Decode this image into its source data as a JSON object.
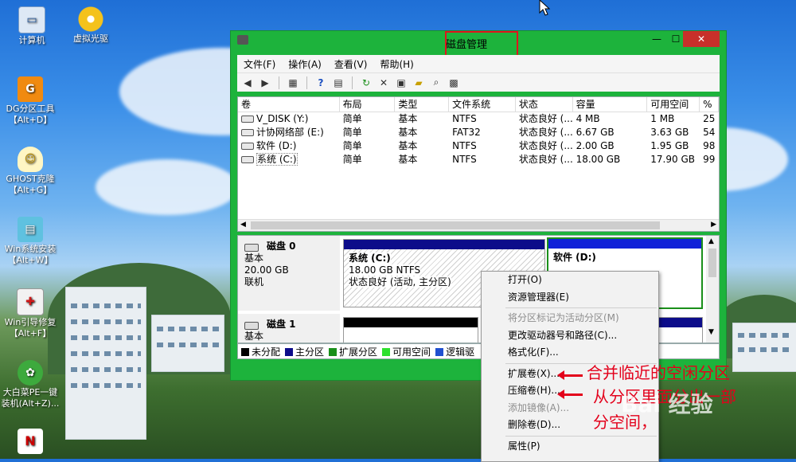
{
  "desktop": {
    "icons": [
      {
        "label": "计算机",
        "icon": "computer-icon"
      },
      {
        "label": "虚拟光驱",
        "icon": "disc-icon"
      },
      {
        "label": "DG分区工具",
        "label2": "【Alt+D】",
        "icon": "diskgenius-icon"
      },
      {
        "label": "GHOST克隆",
        "label2": "【Alt+G】",
        "icon": "ghost-icon"
      },
      {
        "label": "Win系统安装",
        "label2": "【Alt+W】",
        "icon": "win-install-icon"
      },
      {
        "label": "Win引导修复",
        "label2": "【Alt+F】",
        "icon": "boot-repair-icon"
      },
      {
        "label": "大白菜PE一键",
        "label2": "装机(Alt+Z)...",
        "icon": "cabbage-icon"
      }
    ]
  },
  "window": {
    "title": "磁盘管理",
    "min": "—",
    "max": "☐",
    "close": "✕",
    "menu": [
      "文件(F)",
      "操作(A)",
      "查看(V)",
      "帮助(H)"
    ]
  },
  "volumes": {
    "columns": [
      "卷",
      "布局",
      "类型",
      "文件系统",
      "状态",
      "容量",
      "可用空间",
      "%"
    ],
    "rows": [
      [
        "V_DISK (Y:)",
        "简单",
        "基本",
        "NTFS",
        "状态良好 (...",
        "4 MB",
        "1 MB",
        "25"
      ],
      [
        "计协网络部 (E:)",
        "简单",
        "基本",
        "FAT32",
        "状态良好 (...",
        "6.67 GB",
        "3.63 GB",
        "54"
      ],
      [
        "软件 (D:)",
        "简单",
        "基本",
        "NTFS",
        "状态良好 (...",
        "2.00 GB",
        "1.95 GB",
        "98"
      ],
      [
        "系统 (C:)",
        "简单",
        "基本",
        "NTFS",
        "状态良好 (...",
        "18.00 GB",
        "17.90 GB",
        "99"
      ]
    ]
  },
  "disks": {
    "disk0": {
      "name": "磁盘 0",
      "type": "基本",
      "size": "20.00 GB",
      "status": "联机"
    },
    "disk1": {
      "name": "磁盘 1",
      "type": "基本"
    },
    "partC": {
      "name": "系统  (C:)",
      "size": "18.00 GB NTFS",
      "status": "状态良好 (活动, 主分区)"
    },
    "partD": {
      "name": "软件  (D:)"
    }
  },
  "legend": [
    {
      "label": "未分配",
      "color": "#000000"
    },
    {
      "label": "主分区",
      "color": "#0c0c8a"
    },
    {
      "label": "扩展分区",
      "color": "#1a8f1a"
    },
    {
      "label": "可用空间",
      "color": "#2ee02e"
    },
    {
      "label": "逻辑驱",
      "color": "#2050d0"
    }
  ],
  "context_menu": {
    "items": [
      {
        "label": "打开(O)",
        "enabled": true
      },
      {
        "label": "资源管理器(E)",
        "enabled": true
      },
      {
        "sep": true
      },
      {
        "label": "将分区标记为活动分区(M)",
        "enabled": false
      },
      {
        "label": "更改驱动器号和路径(C)...",
        "enabled": true
      },
      {
        "label": "格式化(F)...",
        "enabled": true
      },
      {
        "sep": true
      },
      {
        "label": "扩展卷(X)...",
        "enabled": true
      },
      {
        "label": "压缩卷(H)...",
        "enabled": true
      },
      {
        "label": "添加镜像(A)...",
        "enabled": false
      },
      {
        "label": "删除卷(D)...",
        "enabled": true
      },
      {
        "sep": true
      },
      {
        "label": "属性(P)",
        "enabled": true
      }
    ]
  },
  "annotations": {
    "line1": "合并临近的空闲分区",
    "line2": "从分区里面分出一部",
    "line3": "分空间，"
  },
  "watermark": "Bai 经验",
  "colors": {
    "window_frame": "#1db33c",
    "highlight": "#e0141e",
    "annotation": "#e3001b"
  }
}
